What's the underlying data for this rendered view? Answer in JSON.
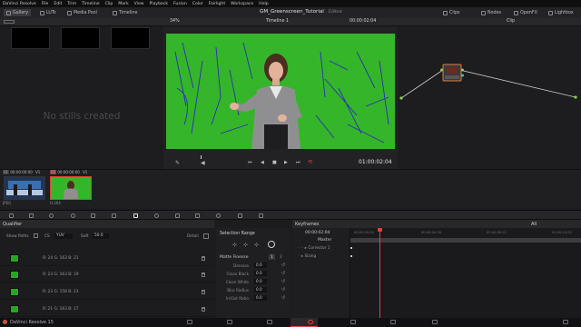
{
  "menu": [
    "DaVinci Resolve",
    "File",
    "Edit",
    "Trim",
    "Timeline",
    "Clip",
    "Mark",
    "View",
    "Playback",
    "Fusion",
    "Color",
    "Fairlight",
    "Workspace",
    "Help"
  ],
  "toolbar": {
    "gallery": "Gallery",
    "luts": "LUTs",
    "media_pool": "Media Pool",
    "timeline": "Timeline",
    "project": "GM_Greenscreen_Tutorial",
    "edited": "Edited",
    "clips": "Clips",
    "nodes": "Nodes",
    "openfx": "OpenFX",
    "lightbox": "Lightbox"
  },
  "viewer_bar": {
    "zoom": "34%",
    "timeline_name": "Timeline 1",
    "timecode": "00:00:02:04",
    "mode": "Clip"
  },
  "gallery": {
    "empty_text": "No stills created"
  },
  "viewer": {
    "timecode": "01:00:02:04"
  },
  "clips": [
    {
      "num": "01",
      "tc": "00:00:00:00",
      "track": "V1",
      "codec": "JPEG"
    },
    {
      "num": "02",
      "tc": "00:00:00:00",
      "track": "V1",
      "codec": "H.264"
    }
  ],
  "qualifier": {
    "title": "Qualifier",
    "show_paths_label": "Show Paths",
    "cs_label": "CS",
    "cs_value": "YUV",
    "soft_label": "Soft",
    "soft_value": "50.0",
    "detail_label": "Detail",
    "rows": [
      {
        "text": "R: 24  G: 163  B: 21"
      },
      {
        "text": "R: 23  G: 163  B: 19"
      },
      {
        "text": "R: 23  G: 158  B: 23"
      },
      {
        "text": "R: 21  G: 163  B: 17"
      }
    ]
  },
  "selection": {
    "title": "Selection Range",
    "matte_label": "Matte Finesse",
    "page1": "1",
    "page2": "2",
    "fields": [
      {
        "label": "Denoise",
        "value": "0.0"
      },
      {
        "label": "Clean Black",
        "value": "0.0"
      },
      {
        "label": "Clean White",
        "value": "0.0"
      },
      {
        "label": "Blur Radius",
        "value": "0.0"
      },
      {
        "label": "In/Out Ratio",
        "value": "0.0"
      }
    ]
  },
  "keyframes": {
    "title": "Keyframes",
    "filter": "All",
    "tc": "00:00:02:04",
    "ticks": [
      "00:00:00:00",
      "00:00:04:26",
      "00:00:09:22",
      "00:00:14:22"
    ],
    "tracks": [
      "Master",
      "Corrector 1",
      "Sizing"
    ]
  },
  "status": {
    "app": "DaVinci Resolve 15"
  },
  "colors": {
    "green": "#35b52a",
    "accent_red": "#e0433a",
    "node_orange": "#d9823a"
  }
}
